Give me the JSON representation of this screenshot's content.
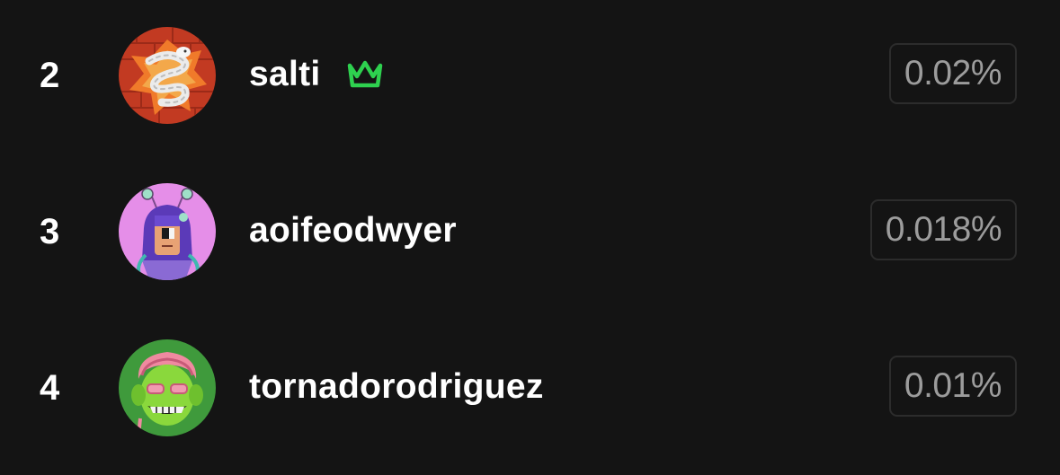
{
  "leaderboard": {
    "rows": [
      {
        "rank": "2",
        "username": "salti",
        "has_crown": true,
        "percentage": "0.02%",
        "avatar_icon": "snake-on-red-bricks-avatar"
      },
      {
        "rank": "3",
        "username": "aoifeodwyer",
        "has_crown": false,
        "percentage": "0.018%",
        "avatar_icon": "purple-haired-character-avatar"
      },
      {
        "rank": "4",
        "username": "tornadorodriguez",
        "has_crown": false,
        "percentage": "0.01%",
        "avatar_icon": "green-goblin-face-avatar"
      }
    ]
  },
  "colors": {
    "background": "#141414",
    "text_primary": "#ffffff",
    "text_muted": "#9c9c9c",
    "crown_accent": "#2ed14f",
    "badge_border": "#2c2c2c"
  }
}
